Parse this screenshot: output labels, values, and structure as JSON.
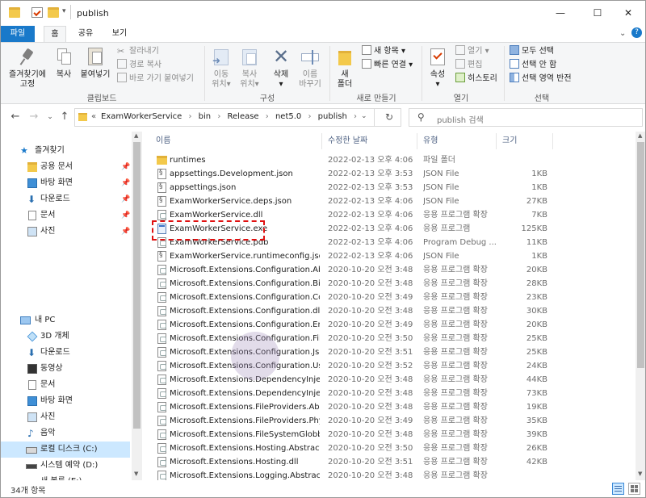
{
  "window": {
    "title": "publish",
    "controls": {
      "minimize": "—",
      "maximize": "☐",
      "close": "✕"
    }
  },
  "ribbon_tabs": [
    "파일",
    "홈",
    "공유",
    "보기"
  ],
  "ribbon": {
    "clipboard": {
      "pin_label_1": "즐겨찾기에",
      "pin_label_2": "고정",
      "copy_label": "복사",
      "paste_label": "붙여넣기",
      "cut_label": "잘라내기",
      "copy_path_label": "경로 복사",
      "paste_shortcut_label": "바로 가기 붙여넣기",
      "group_label": "클립보드"
    },
    "organize": {
      "move_label_1": "이동",
      "move_label_2": "위치▾",
      "copyto_label_1": "복사",
      "copyto_label_2": "위치▾",
      "delete_label_1": "삭제",
      "delete_label_2": "▾",
      "rename_label_1": "이름",
      "rename_label_2": "바꾸기",
      "group_label": "구성"
    },
    "new": {
      "new_folder_label_1": "새",
      "new_folder_label_2": "폴더",
      "new_item_label": "새 항목 ▾",
      "easy_access_label": "빠른 연결 ▾",
      "group_label": "새로 만들기"
    },
    "open": {
      "properties_label_1": "속성",
      "properties_label_2": "▾",
      "open_label": "열기 ▾",
      "edit_label": "편집",
      "history_label": "히스토리",
      "group_label": "열기"
    },
    "select": {
      "select_all_label": "모두 선택",
      "select_none_label": "선택 안 함",
      "invert_label": "선택 영역 반전",
      "group_label": "선택"
    }
  },
  "address": {
    "breadcrumb": [
      "ExamWorkerService",
      "bin",
      "Release",
      "net5.0",
      "publish"
    ],
    "prefix": "«",
    "search_placeholder": "publish 검색"
  },
  "nav": {
    "quick_access": "즐겨찾기",
    "quick_items": [
      "공용 문서",
      "바탕 화면",
      "다운로드",
      "문서",
      "사진"
    ],
    "this_pc": "내 PC",
    "pc_items": [
      "3D 개체",
      "다운로드",
      "동영상",
      "문서",
      "바탕 화면",
      "사진",
      "음악",
      "로컬 디스크 (C:)",
      "시스템 예약 (D:)",
      "새 볼륨 (E:)"
    ]
  },
  "columns": {
    "name": "이름",
    "date": "수정한 날짜",
    "type": "유형",
    "size": "크기"
  },
  "files": [
    {
      "name": "runtimes",
      "date": "2022-02-13 오후 4:06",
      "type": "파일 폴더",
      "size": "",
      "icon": "folder-icon"
    },
    {
      "name": "appsettings.Development.json",
      "date": "2022-02-13 오후 3:53",
      "type": "JSON File",
      "size": "1KB",
      "icon": "json-file-icon"
    },
    {
      "name": "appsettings.json",
      "date": "2022-02-13 오후 3:53",
      "type": "JSON File",
      "size": "1KB",
      "icon": "json-file-icon"
    },
    {
      "name": "ExamWorkerService.deps.json",
      "date": "2022-02-13 오후 4:06",
      "type": "JSON File",
      "size": "27KB",
      "icon": "json-file-icon"
    },
    {
      "name": "ExamWorkerService.dll",
      "date": "2022-02-13 오후 4:06",
      "type": "응용 프로그램 확장",
      "size": "7KB",
      "icon": "dll-file-icon"
    },
    {
      "name": "ExamWorkerService.exe",
      "date": "2022-02-13 오후 4:06",
      "type": "응용 프로그램",
      "size": "125KB",
      "icon": "exe-file-icon"
    },
    {
      "name": "ExamWorkerService.pdb",
      "date": "2022-02-13 오후 4:06",
      "type": "Program Debug ...",
      "size": "11KB",
      "icon": "pdb-file-icon"
    },
    {
      "name": "ExamWorkerService.runtimeconfig.json",
      "date": "2022-02-13 오후 4:06",
      "type": "JSON File",
      "size": "1KB",
      "icon": "json-file-icon"
    },
    {
      "name": "Microsoft.Extensions.Configuration.Abst...",
      "date": "2020-10-20 오전 3:48",
      "type": "응용 프로그램 확장",
      "size": "20KB",
      "icon": "dll-file-icon"
    },
    {
      "name": "Microsoft.Extensions.Configuration.Bind...",
      "date": "2020-10-20 오전 3:48",
      "type": "응용 프로그램 확장",
      "size": "28KB",
      "icon": "dll-file-icon"
    },
    {
      "name": "Microsoft.Extensions.Configuration.Com...",
      "date": "2020-10-20 오전 3:49",
      "type": "응용 프로그램 확장",
      "size": "23KB",
      "icon": "dll-file-icon"
    },
    {
      "name": "Microsoft.Extensions.Configuration.dll",
      "date": "2020-10-20 오전 3:48",
      "type": "응용 프로그램 확장",
      "size": "30KB",
      "icon": "dll-file-icon"
    },
    {
      "name": "Microsoft.Extensions.Configuration.Envir...",
      "date": "2020-10-20 오전 3:49",
      "type": "응용 프로그램 확장",
      "size": "20KB",
      "icon": "dll-file-icon"
    },
    {
      "name": "Microsoft.Extensions.Configuration.FileE...",
      "date": "2020-10-20 오전 3:50",
      "type": "응용 프로그램 확장",
      "size": "25KB",
      "icon": "dll-file-icon"
    },
    {
      "name": "Microsoft.Extensions.Configuration.Json....",
      "date": "2020-10-20 오전 3:51",
      "type": "응용 프로그램 확장",
      "size": "25KB",
      "icon": "dll-file-icon"
    },
    {
      "name": "Microsoft.Extensions.Configuration.User...",
      "date": "2020-10-20 오전 3:52",
      "type": "응용 프로그램 확장",
      "size": "24KB",
      "icon": "dll-file-icon"
    },
    {
      "name": "Microsoft.Extensions.DependencyInjecti...",
      "date": "2020-10-20 오전 3:48",
      "type": "응용 프로그램 확장",
      "size": "44KB",
      "icon": "dll-file-icon"
    },
    {
      "name": "Microsoft.Extensions.DependencyInjecti...",
      "date": "2020-10-20 오전 3:48",
      "type": "응용 프로그램 확장",
      "size": "73KB",
      "icon": "dll-file-icon"
    },
    {
      "name": "Microsoft.Extensions.FileProviders.Abstra...",
      "date": "2020-10-20 오전 3:48",
      "type": "응용 프로그램 확장",
      "size": "19KB",
      "icon": "dll-file-icon"
    },
    {
      "name": "Microsoft.Extensions.FileProviders.Physic...",
      "date": "2020-10-20 오전 3:49",
      "type": "응용 프로그램 확장",
      "size": "35KB",
      "icon": "dll-file-icon"
    },
    {
      "name": "Microsoft.Extensions.FileSystemGlobbin...",
      "date": "2020-10-20 오전 3:48",
      "type": "응용 프로그램 확장",
      "size": "39KB",
      "icon": "dll-file-icon"
    },
    {
      "name": "Microsoft.Extensions.Hosting.Abstractio...",
      "date": "2020-10-20 오전 3:50",
      "type": "응용 프로그램 확장",
      "size": "26KB",
      "icon": "dll-file-icon"
    },
    {
      "name": "Microsoft.Extensions.Hosting.dll",
      "date": "2020-10-20 오전 3:51",
      "type": "응용 프로그램 확장",
      "size": "42KB",
      "icon": "dll-file-icon"
    },
    {
      "name": "Microsoft.Extensions.Logging.Abstractio...",
      "date": "2020-10-20 오전 3:48",
      "type": "응용 프로그램 확장",
      "size": "",
      "icon": "dll-file-icon"
    }
  ],
  "status": {
    "item_count": "34개 항목"
  },
  "colors": {
    "accent": "#1979ca",
    "highlight_border": "#e01010",
    "selected_nav": "#cce8ff"
  }
}
